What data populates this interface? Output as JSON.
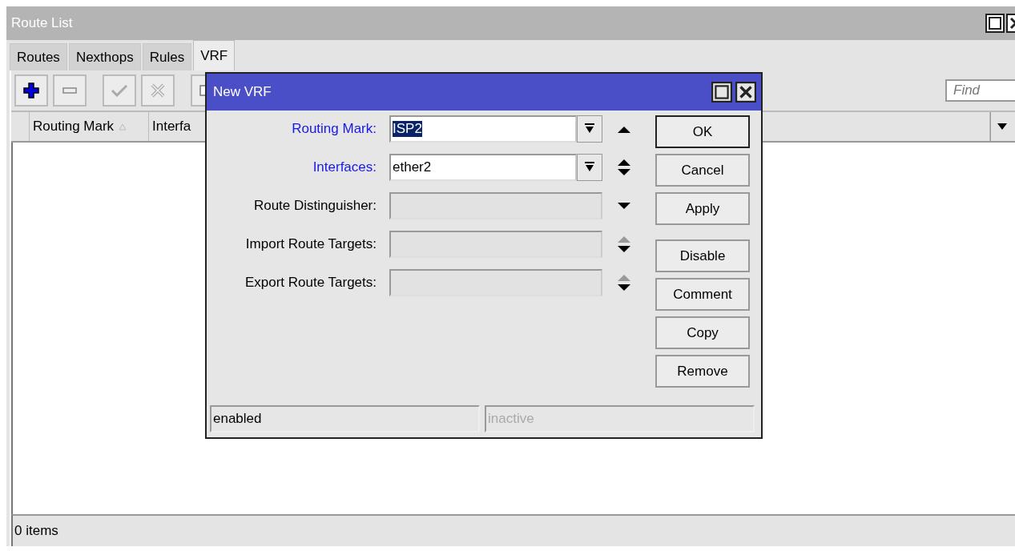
{
  "window": {
    "title": "Route List"
  },
  "tabs": [
    {
      "label": "Routes",
      "selected": false
    },
    {
      "label": "Nexthops",
      "selected": false
    },
    {
      "label": "Rules",
      "selected": false
    },
    {
      "label": "VRF",
      "selected": true
    }
  ],
  "toolbar": [
    {
      "kind": "add"
    },
    {
      "kind": "remove"
    },
    {
      "kind": "enable",
      "disabled": true
    },
    {
      "kind": "disable",
      "disabled": true
    },
    {
      "kind": "comment"
    }
  ],
  "search": {
    "placeholder": "Find"
  },
  "table": {
    "columns": [
      {
        "label": "Routing Mark",
        "sorted": true
      },
      {
        "label": "Interfa",
        "sorted": false
      }
    ]
  },
  "status_bar": "0 items",
  "dialog": {
    "title": "New VRF",
    "fields": [
      {
        "label": "Routing Mark:",
        "value": "ISP2",
        "value_selected": true,
        "emphasized": true,
        "kind": "combo",
        "up_arrow": true,
        "down_arrow": false,
        "up_dim": false
      },
      {
        "label": "Interfaces:",
        "value": "ether2",
        "value_selected": false,
        "emphasized": true,
        "kind": "combo",
        "up_arrow": true,
        "down_arrow": true,
        "up_dim": false
      },
      {
        "label": "Route Distinguisher:",
        "emphasized": false,
        "kind": "list",
        "up_arrow": false,
        "down_arrow": true
      },
      {
        "label": "Import Route Targets:",
        "emphasized": false,
        "kind": "list",
        "up_arrow": true,
        "down_arrow": true,
        "up_dim": true
      },
      {
        "label": "Export Route Targets:",
        "emphasized": false,
        "kind": "list",
        "up_arrow": true,
        "down_arrow": true,
        "up_dim": true
      }
    ],
    "button_groups": [
      [
        {
          "label": "OK",
          "default": true
        },
        {
          "label": "Cancel",
          "default": false
        },
        {
          "label": "Apply",
          "default": false
        }
      ],
      [
        {
          "label": "Disable",
          "default": false
        },
        {
          "label": "Comment",
          "default": false
        },
        {
          "label": "Copy",
          "default": false
        },
        {
          "label": "Remove",
          "default": false
        }
      ]
    ],
    "status": [
      {
        "text": "enabled",
        "disabled": false
      },
      {
        "text": "inactive",
        "disabled": true
      }
    ]
  }
}
